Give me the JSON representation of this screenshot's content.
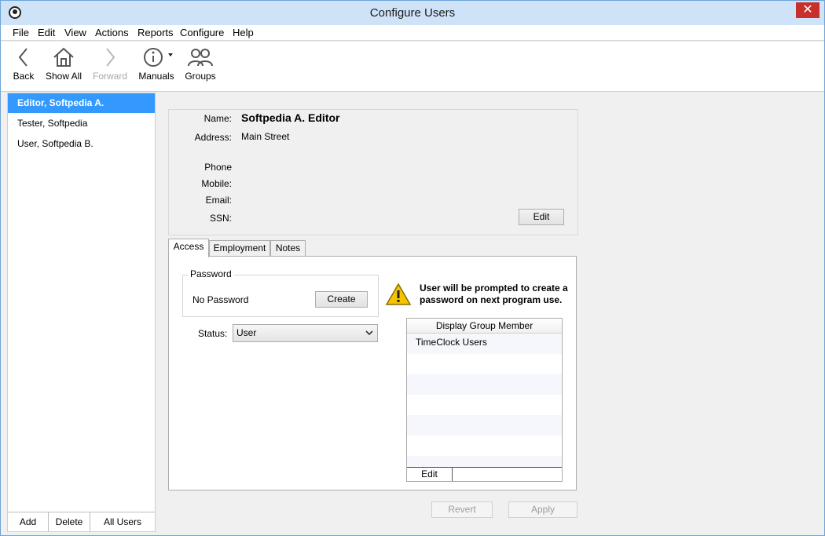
{
  "window": {
    "title": "Configure Users",
    "close_label": "✕"
  },
  "menu": [
    "File",
    "Edit",
    "View",
    "Actions",
    "Reports",
    "Configure",
    "Help"
  ],
  "toolbar": {
    "back": "Back",
    "show_all": "Show All",
    "forward": "Forward",
    "manuals": "Manuals",
    "groups": "Groups"
  },
  "users": [
    {
      "label": "Editor, Softpedia A.",
      "selected": true
    },
    {
      "label": "Tester, Softpedia",
      "selected": false
    },
    {
      "label": "User, Softpedia B.",
      "selected": false
    }
  ],
  "sidebar_footer": {
    "add": "Add",
    "delete": "Delete",
    "all_users": "All Users"
  },
  "details": {
    "name_label": "Name:",
    "name": "Softpedia A. Editor",
    "address_label": "Address:",
    "address": "Main Street",
    "phone_label": "Phone",
    "mobile_label": "Mobile:",
    "email_label": "Email:",
    "ssn_label": "SSN:",
    "edit_label": "Edit"
  },
  "tabs": [
    "Access",
    "Employment",
    "Notes"
  ],
  "access": {
    "password_legend": "Password",
    "password_status": "No Password",
    "create_label": "Create",
    "status_label": "Status:",
    "status_value": "User",
    "warning": "User will be prompted to create a password on next program use.",
    "group_header": "Display Group Member",
    "groups": [
      "TimeClock Users"
    ],
    "group_edit": "Edit"
  },
  "actions": {
    "revert": "Revert",
    "apply": "Apply"
  },
  "colors": {
    "selection": "#3399ff",
    "title_bar": "#cfe3f8",
    "warning": "#f5c400"
  }
}
